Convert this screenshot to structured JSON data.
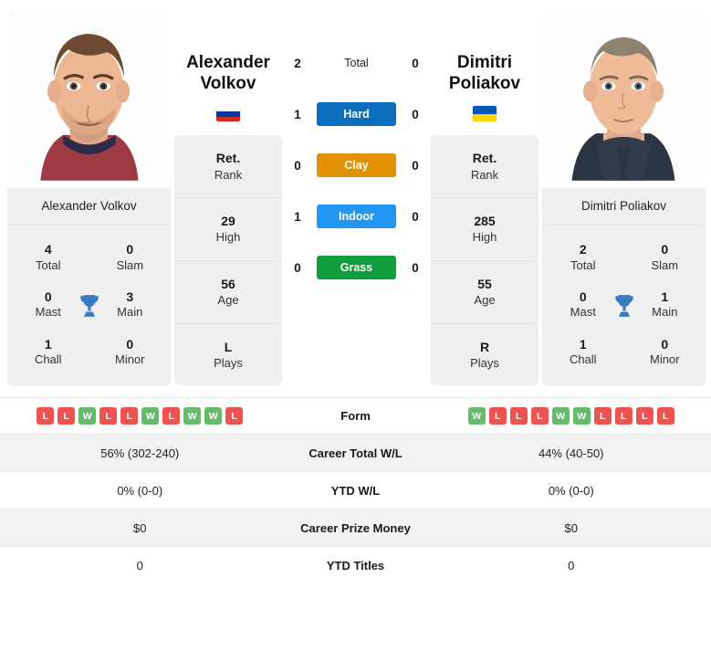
{
  "players": {
    "left": {
      "name": "Alexander Volkov",
      "first_name": "Alexander",
      "last_name": "Volkov",
      "country": "Russia",
      "flag_colors": [
        "#ffffff",
        "#0039a6",
        "#d52b1e"
      ],
      "rank": "Ret.",
      "rank_label": "Rank",
      "high": "29",
      "high_label": "High",
      "age": "56",
      "age_label": "Age",
      "plays": "L",
      "plays_label": "Plays",
      "titles": {
        "total": "4",
        "total_label": "Total",
        "slam": "0",
        "slam_label": "Slam",
        "mast": "0",
        "mast_label": "Mast",
        "main": "3",
        "main_label": "Main",
        "chall": "1",
        "chall_label": "Chall",
        "minor": "0",
        "minor_label": "Minor"
      },
      "form": [
        "L",
        "L",
        "W",
        "L",
        "L",
        "W",
        "L",
        "W",
        "W",
        "L"
      ],
      "career_wl": "56% (302-240)",
      "ytd_wl": "0% (0-0)",
      "prize_money": "$0",
      "ytd_titles": "0"
    },
    "right": {
      "name": "Dimitri Poliakov",
      "first_name": "Dimitri",
      "last_name": "Poliakov",
      "country": "Ukraine",
      "flag_colors": [
        "#0057b7",
        "#ffd700"
      ],
      "rank": "Ret.",
      "rank_label": "Rank",
      "high": "285",
      "high_label": "High",
      "age": "55",
      "age_label": "Age",
      "plays": "R",
      "plays_label": "Plays",
      "titles": {
        "total": "2",
        "total_label": "Total",
        "slam": "0",
        "slam_label": "Slam",
        "mast": "0",
        "mast_label": "Mast",
        "main": "1",
        "main_label": "Main",
        "chall": "1",
        "chall_label": "Chall",
        "minor": "0",
        "minor_label": "Minor"
      },
      "form": [
        "W",
        "L",
        "L",
        "L",
        "W",
        "W",
        "L",
        "L",
        "L",
        "L"
      ],
      "career_wl": "44% (40-50)",
      "ytd_wl": "0% (0-0)",
      "prize_money": "$0",
      "ytd_titles": "0"
    }
  },
  "head_to_head": [
    {
      "label": "Total",
      "left": "2",
      "right": "0",
      "style": "plain",
      "color": ""
    },
    {
      "label": "Hard",
      "left": "1",
      "right": "0",
      "style": "pill",
      "color": "#0b6dbd"
    },
    {
      "label": "Clay",
      "left": "0",
      "right": "0",
      "style": "pill",
      "color": "#e29100"
    },
    {
      "label": "Indoor",
      "left": "1",
      "right": "0",
      "style": "pill",
      "color": "#2196f3"
    },
    {
      "label": "Grass",
      "left": "0",
      "right": "0",
      "style": "pill",
      "color": "#0f9d3e"
    }
  ],
  "stats_rows": [
    {
      "label": "Form",
      "left": "",
      "right": "",
      "type": "form"
    },
    {
      "label": "Career Total W/L",
      "left": "56% (302-240)",
      "right": "44% (40-50)",
      "type": "text"
    },
    {
      "label": "YTD W/L",
      "left": "0% (0-0)",
      "right": "0% (0-0)",
      "type": "text"
    },
    {
      "label": "Career Prize Money",
      "left": "$0",
      "right": "$0",
      "type": "text"
    },
    {
      "label": "YTD Titles",
      "left": "0",
      "right": "0",
      "type": "text"
    }
  ],
  "icons": {
    "trophy": "trophy-icon"
  },
  "colors": {
    "win": "#66bb6a",
    "loss": "#ef5350",
    "card": "#efefef",
    "alt_row": "#f2f2f2"
  }
}
